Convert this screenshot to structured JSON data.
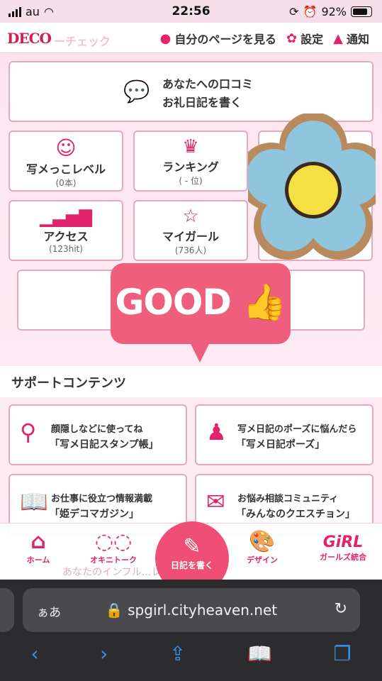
{
  "status": {
    "carrier": "au",
    "time": "22:56",
    "battery": "92%"
  },
  "topnav": {
    "logo": "DECO",
    "logo_tail": "ーチェック",
    "mypage": "自分のページを見る",
    "settings": "設定",
    "notice": "通知"
  },
  "review": {
    "line1": "あなたへの口コミ",
    "line2": "お礼日記を書く"
  },
  "cards": [
    {
      "label": "写メっこレベル",
      "sub": "(0本)"
    },
    {
      "label": "ランキング",
      "sub": "( - 位)"
    },
    {
      "label": "アクセス",
      "sub": "(123hit)"
    },
    {
      "label": "マイガール",
      "sub": "(736人)"
    }
  ],
  "overlay": {
    "good": "GOOD"
  },
  "support": {
    "title": "サポートコンテンツ",
    "items": [
      {
        "t1": "顔隠しなどに使ってね",
        "t2": "「写メ日記スタンプ帳」"
      },
      {
        "t1": "写メ日記のポーズに悩んだら",
        "t2": "「写メ日記ポーズ」"
      },
      {
        "t1": "お仕事に役立つ情報満載",
        "t2": "「姫デコマガジン」"
      },
      {
        "t1": "お悩み相談コミュニティ",
        "t2": "「みんなのクエスチョン」"
      }
    ]
  },
  "faded_text": "あなたのインフル…レベルはこちら",
  "tabbar": {
    "home": "ホーム",
    "talk": "オキニトーク",
    "write": "日記を書く",
    "design": "デザイン",
    "girls": "ガールズ統合"
  },
  "safari": {
    "aa": "ぁあ",
    "host": "spgirl.cityheaven.net"
  }
}
